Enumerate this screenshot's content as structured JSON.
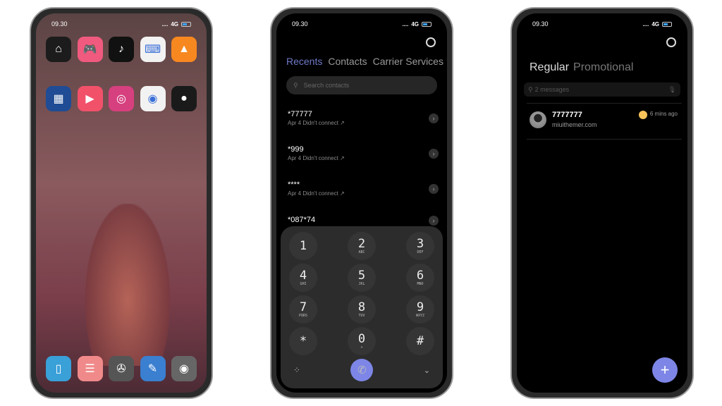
{
  "status": {
    "time": "09.30",
    "signal": "....",
    "network": "4G"
  },
  "home": {
    "row1": [
      {
        "icon": "home-app-icon",
        "color": "#1c1c1c",
        "glyph": "⌂"
      },
      {
        "icon": "game-controller-icon",
        "color": "#f05a7e",
        "glyph": "🎮"
      },
      {
        "icon": "tiktok-icon",
        "color": "#111111",
        "glyph": "♪"
      },
      {
        "icon": "swiftkey-keyboard-icon",
        "color": "#f2f2f2",
        "glyph": "⌨"
      },
      {
        "icon": "vlc-cone-icon",
        "color": "#f7881f",
        "glyph": "▲"
      }
    ],
    "row2": [
      {
        "icon": "windows-tiles-icon",
        "color": "#1f4c94",
        "glyph": "▦"
      },
      {
        "icon": "video-player-icon",
        "color": "#f2516a",
        "glyph": "▶"
      },
      {
        "icon": "instagram-icon",
        "color": "#d6407f",
        "glyph": "◎"
      },
      {
        "icon": "chrome-icon",
        "color": "#f2f2f2",
        "glyph": "◉"
      },
      {
        "icon": "bird-icon",
        "color": "#1a1a1a",
        "glyph": "●"
      }
    ],
    "dock": [
      {
        "icon": "phone-app-icon",
        "color": "#3aa0d8",
        "glyph": "▯"
      },
      {
        "icon": "messages-icon",
        "color": "#f08a8a",
        "glyph": "☰"
      },
      {
        "icon": "mercedes-logo-icon",
        "color": "#555555",
        "glyph": "✇"
      },
      {
        "icon": "notes-icon",
        "color": "#3a7fd0",
        "glyph": "✎"
      },
      {
        "icon": "camera-icon",
        "color": "#666666",
        "glyph": "◉"
      }
    ]
  },
  "dialer": {
    "tabs": [
      "Recents",
      "Contacts",
      "Carrier Services"
    ],
    "search_placeholder": "Search contacts",
    "calls": [
      {
        "number": "*77777",
        "detail": "Apr 4 Didn't connect ↗"
      },
      {
        "number": "*999",
        "detail": "Apr 4 Didn't connect ↗"
      },
      {
        "number": "****",
        "detail": "Apr 4 Didn't connect ↗"
      },
      {
        "number": "*087*74",
        "detail": ""
      }
    ],
    "keys": [
      {
        "d": "1",
        "l": ""
      },
      {
        "d": "2",
        "l": "ABC"
      },
      {
        "d": "3",
        "l": "DEF"
      },
      {
        "d": "4",
        "l": "GHI"
      },
      {
        "d": "5",
        "l": "JKL"
      },
      {
        "d": "6",
        "l": "MNO"
      },
      {
        "d": "7",
        "l": "PQRS"
      },
      {
        "d": "8",
        "l": "TUV"
      },
      {
        "d": "9",
        "l": "WXYZ"
      },
      {
        "d": "*",
        "l": ""
      },
      {
        "d": "0",
        "l": "+"
      },
      {
        "d": "#",
        "l": ""
      }
    ],
    "accent": "#7d86e6"
  },
  "messages": {
    "tabs": [
      "Regular",
      "Promotional"
    ],
    "search_placeholder": "2 messages",
    "thread": {
      "name": "7777777",
      "preview": "miuithemer.com",
      "time": "6 mins ago",
      "badge_color": "#f6c35a"
    },
    "fab": "+"
  }
}
